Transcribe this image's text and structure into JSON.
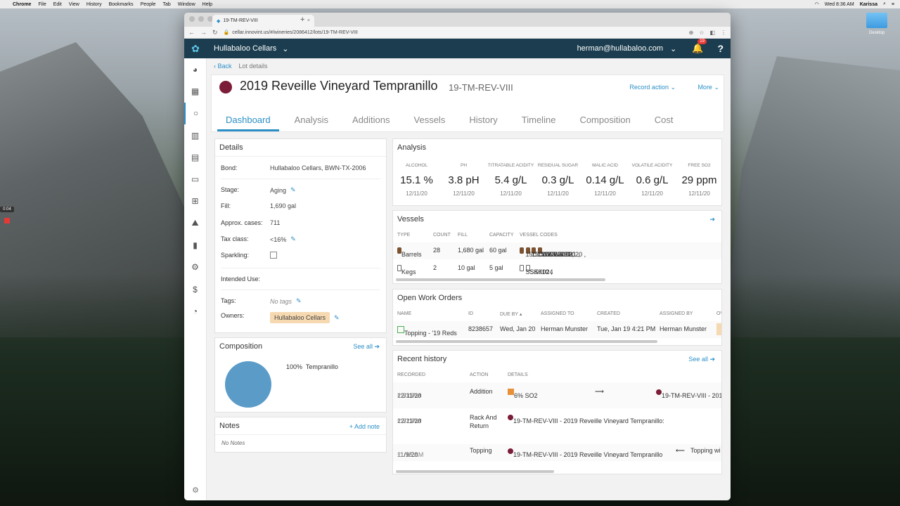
{
  "menubar": {
    "app": "Chrome",
    "items": [
      "File",
      "Edit",
      "View",
      "History",
      "Bookmarks",
      "People",
      "Tab",
      "Window",
      "Help"
    ],
    "clock": "Wed 8:36 AM",
    "user": "Karissa"
  },
  "desktop": {
    "folder_label": "Desktop",
    "recording_time": "0:04"
  },
  "browser": {
    "tab_title": "19-TM-REV-VIII",
    "url": "cellar.innovint.us/#/wineries/2086412/lots/19-TM-REV-VIII"
  },
  "header": {
    "org": "Hullabaloo Cellars",
    "user_email": "herman@hullabaloo.com",
    "notif_count": "19",
    "help": "?"
  },
  "breadcrumb": {
    "back": "Back",
    "current": "Lot details"
  },
  "lot": {
    "name": "2019 Reveille Vineyard Tempranillo",
    "code": "19-TM-REV-VIII",
    "record_action": "Record action",
    "more": "More",
    "color": "#7b1c38"
  },
  "tabs": [
    "Dashboard",
    "Analysis",
    "Additions",
    "Vessels",
    "History",
    "Timeline",
    "Composition",
    "Cost"
  ],
  "details": {
    "title": "Details",
    "bond_k": "Bond:",
    "bond_v": "Hullabaloo Cellars, BWN-TX-2006",
    "stage_k": "Stage:",
    "stage_v": "Aging",
    "fill_k": "Fill:",
    "fill_v": "1,690 gal",
    "cases_k": "Approx. cases:",
    "cases_v": "711",
    "tax_k": "Tax class:",
    "tax_v": "<16%",
    "spark_k": "Sparkling:",
    "intended_k": "Intended Use:",
    "tags_k": "Tags:",
    "tags_v": "No tags",
    "owners_k": "Owners:",
    "owners_v": "Hullabaloo Cellars"
  },
  "composition": {
    "title": "Composition",
    "see_all": "See all",
    "pct": "100%",
    "variety": "Tempranillo"
  },
  "notes": {
    "title": "Notes",
    "add": "Add note",
    "empty": "No Notes"
  },
  "analysis": {
    "title": "Analysis",
    "cols": [
      {
        "h": "ALCOHOL",
        "v": "15.1 %",
        "d": "12/11/20"
      },
      {
        "h": "PH",
        "v": "3.8 pH",
        "d": "12/11/20"
      },
      {
        "h": "TITRATABLE ACIDITY",
        "v": "5.4 g/L",
        "d": "12/11/20"
      },
      {
        "h": "RESIDUAL SUGAR",
        "v": "0.3 g/L",
        "d": "12/11/20"
      },
      {
        "h": "MALIC ACID",
        "v": "0.14 g/L",
        "d": "12/11/20"
      },
      {
        "h": "VOLATILE ACIDITY",
        "v": "0.6 g/L",
        "d": "12/11/20"
      },
      {
        "h": "FREE SO2",
        "v": "29 ppm",
        "d": "12/11/20"
      }
    ]
  },
  "vessels": {
    "title": "Vessels",
    "headers": [
      "TYPE",
      "COUNT",
      "FILL",
      "CAPACITY",
      "VESSEL CODES"
    ],
    "rows": [
      {
        "type": "Barrels",
        "count": "28",
        "fill": "1,680 gal",
        "cap": "60 gal",
        "codes": [
          "15CCWBBL010 ,",
          "15CCWBBL021 ,",
          "15CCWBBL020 ,",
          "18CCWBB"
        ]
      },
      {
        "type": "Kegs",
        "count": "2",
        "fill": "10 gal",
        "cap": "5 gal",
        "codes": [
          "SSK010 ,",
          "SSK024"
        ]
      }
    ]
  },
  "work_orders": {
    "title": "Open Work Orders",
    "headers": [
      "NAME",
      "ID",
      "DUE BY",
      "ASSIGNED TO",
      "CREATED",
      "ASSIGNED BY",
      "OV"
    ],
    "row": {
      "name": "Topping - '19 Reds",
      "id": "8238657",
      "due": "Wed, Jan 20",
      "to": "Herman Munster",
      "created": "Tue, Jan 19 4:21 PM",
      "by": "Herman Munster"
    }
  },
  "history": {
    "title": "Recent history",
    "see_all": "See all",
    "headers": [
      "RECORDED",
      "ACTION",
      "DETAILS"
    ],
    "rows": [
      {
        "date": "12/11/20",
        "time": "2:33 PM",
        "action": "Addition",
        "detail": "6% SO2",
        "target": "19-TM-REV-VIII - 201"
      },
      {
        "date": "12/11/20",
        "time": "2:32 PM",
        "action": "Rack And Return",
        "detail": "19-TM-REV-VIII - 2019 Reveille Vineyard Tempranillo:"
      },
      {
        "date": "11/9/20",
        "time": "11:15 AM",
        "action": "Topping",
        "detail": "19-TM-REV-VIII - 2019 Reveille Vineyard Tempranillo",
        "target": "Topping wi"
      }
    ]
  }
}
